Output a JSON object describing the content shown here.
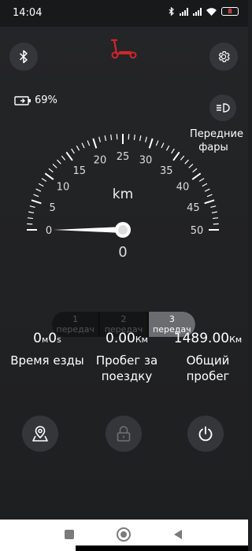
{
  "status_bar": {
    "time": "14:04",
    "battery_level": "8"
  },
  "battery": {
    "percent": "69%"
  },
  "headlights": {
    "label_line1": "Передние",
    "label_line2": "фары"
  },
  "speedometer": {
    "unit": "km",
    "current_speed": "0",
    "tick_labels": [
      "0",
      "5",
      "10",
      "15",
      "20",
      "25",
      "30",
      "35",
      "40",
      "45",
      "50"
    ],
    "needle_color": "#ffffff"
  },
  "gears": [
    {
      "number": "1",
      "label": "передач",
      "active": false
    },
    {
      "number": "2",
      "label": "передач",
      "active": false
    },
    {
      "number": "3",
      "label": "передач",
      "active": true
    }
  ],
  "stats": {
    "ride_time": {
      "value_main": "0",
      "unit1": "м",
      "value_mid": "0",
      "unit2": "s",
      "label_line1": "Время езды",
      "label_line2": ""
    },
    "trip_distance": {
      "value": "0.00",
      "unit": "Км",
      "label_line1": "Пробег за",
      "label_line2": "поездку"
    },
    "total_distance": {
      "value": "1489.00",
      "unit": "Км",
      "label_line1": "Общий",
      "label_line2": "пробег"
    }
  },
  "colors": {
    "accent_red": "#d0262c",
    "background": "#1e1f21",
    "button_bg": "#34363a"
  }
}
